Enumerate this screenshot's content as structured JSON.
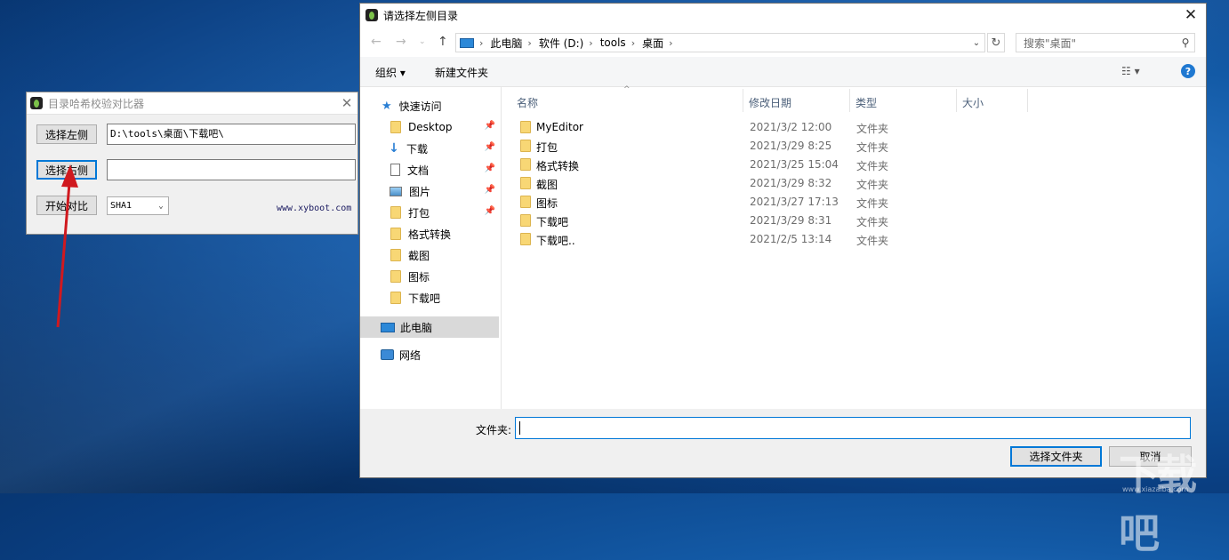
{
  "app": {
    "title": "目录哈希校验对比器",
    "close_glyph": "✕",
    "left_button": "选择左侧",
    "left_path": "D:\\tools\\桌面\\下载吧\\",
    "right_button": "选择右侧",
    "right_path": "",
    "compare_button": "开始对比",
    "algorithm": "SHA1",
    "website": "www.xyboot.com"
  },
  "dialog": {
    "title": "请选择左侧目录",
    "close_glyph": "✕",
    "breadcrumb": [
      "此电脑",
      "软件 (D:)",
      "tools",
      "桌面"
    ],
    "search_placeholder": "搜索\"桌面\"",
    "toolbar": {
      "organize": "组织 ▾",
      "new_folder": "新建文件夹"
    },
    "nav": {
      "quick_access": "快速访问",
      "pinned": [
        "Desktop",
        "下载",
        "文档",
        "图片",
        "打包"
      ],
      "folders": [
        "格式转换",
        "截图",
        "图标",
        "下载吧"
      ],
      "this_pc": "此电脑",
      "network": "网络"
    },
    "columns": {
      "name": "名称",
      "date": "修改日期",
      "type": "类型",
      "size": "大小"
    },
    "rows": [
      {
        "name": "MyEditor",
        "date": "2021/3/2 12:00",
        "type": "文件夹"
      },
      {
        "name": "打包",
        "date": "2021/3/29 8:25",
        "type": "文件夹"
      },
      {
        "name": "格式转换",
        "date": "2021/3/25 15:04",
        "type": "文件夹"
      },
      {
        "name": "截图",
        "date": "2021/3/29 8:32",
        "type": "文件夹"
      },
      {
        "name": "图标",
        "date": "2021/3/27 17:13",
        "type": "文件夹"
      },
      {
        "name": "下载吧",
        "date": "2021/3/29 8:31",
        "type": "文件夹"
      },
      {
        "name": "下载吧..",
        "date": "2021/2/5 13:14",
        "type": "文件夹"
      }
    ],
    "folder_label": "文件夹:",
    "folder_value": "",
    "select_button": "选择文件夹",
    "cancel_button": "取消"
  },
  "watermark": {
    "main": "下载吧",
    "sub": "www.xiazaiba.com"
  },
  "colors": {
    "accent": "#0078d7",
    "annotation_arrow": "#d0191f",
    "folder": "#f8d775"
  }
}
